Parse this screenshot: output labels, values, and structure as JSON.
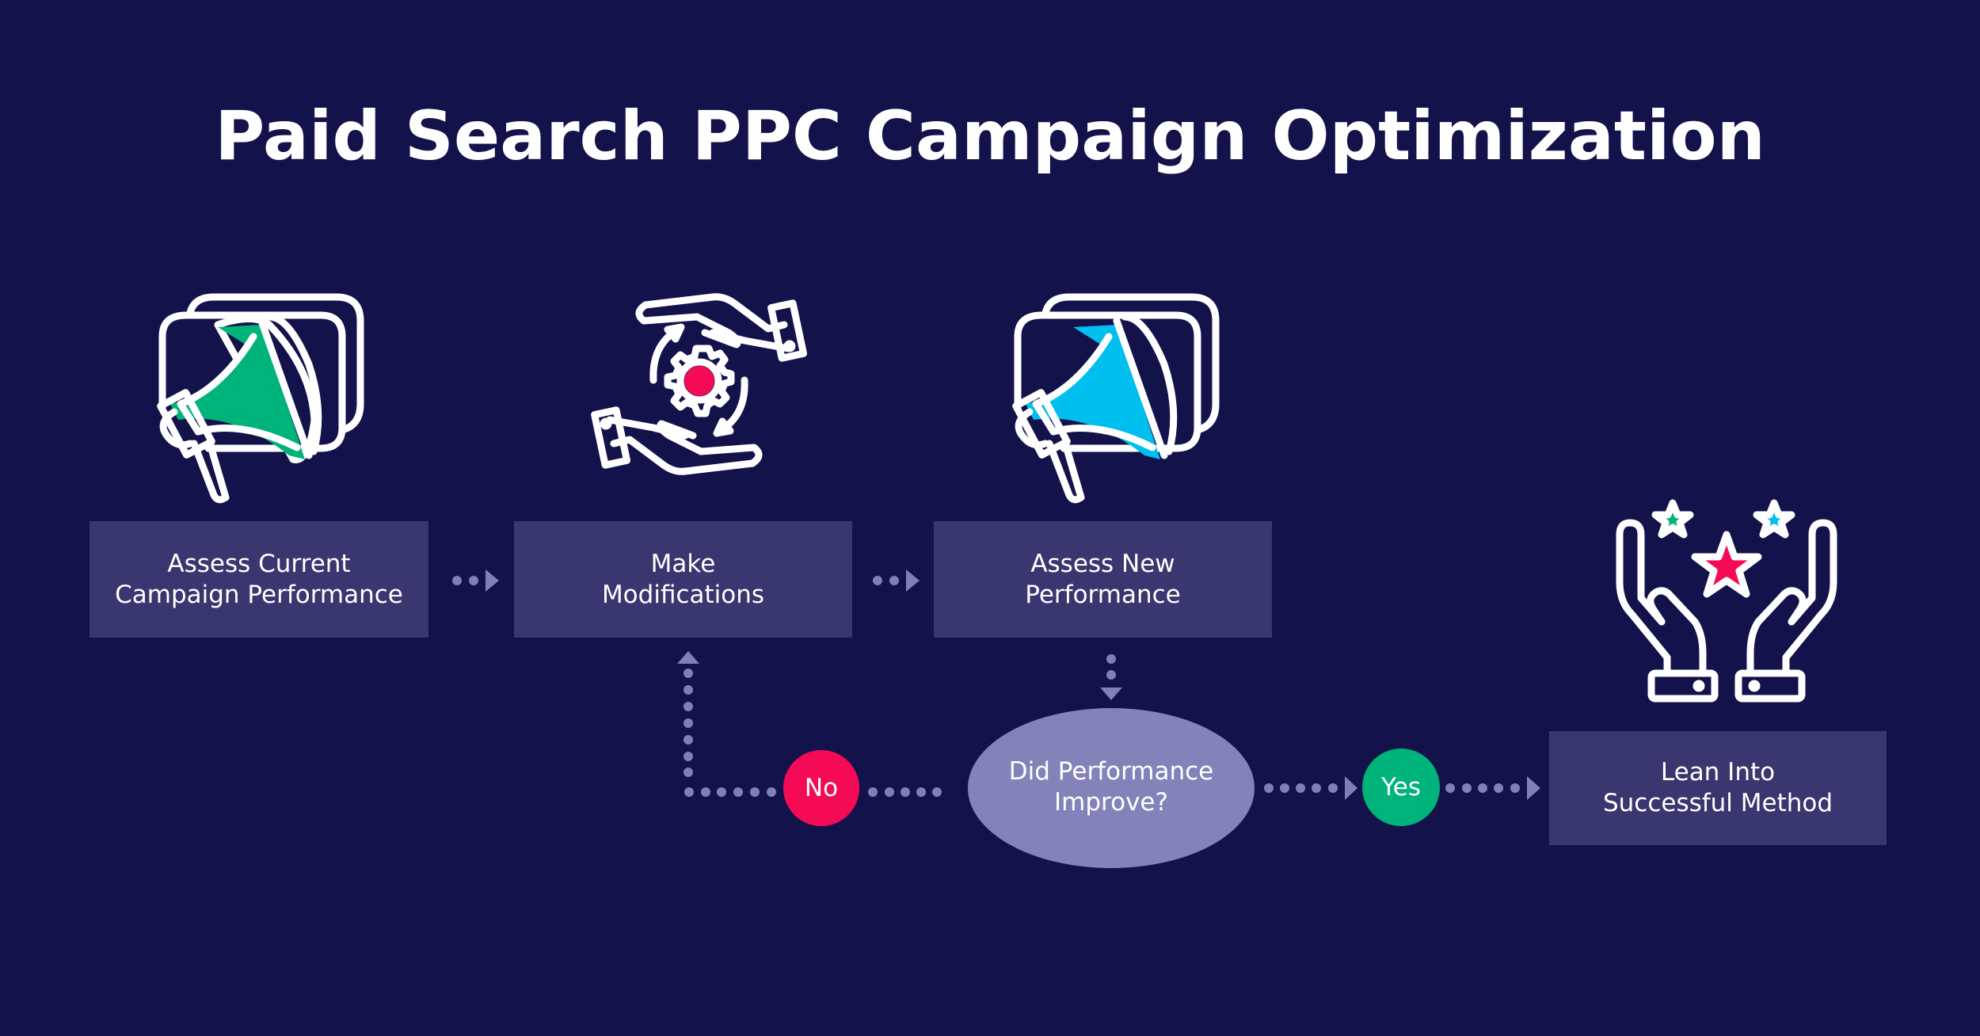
{
  "title": "Paid Search PPC Campaign Optimization",
  "colors": {
    "background": "#13124A",
    "box": "#393670",
    "connector": "#8080B8",
    "decision": "#8383BA",
    "no": "#F50A55",
    "yes": "#00B37A",
    "accent_green": "#00B37A",
    "accent_cyan": "#00BFEF",
    "accent_pink": "#F50A55"
  },
  "steps": [
    {
      "id": "assess-current",
      "label": "Assess Current\nCampaign Performance",
      "icon": "megaphone-screen-icon",
      "icon_accent": "green"
    },
    {
      "id": "make-modifications",
      "label": "Make\nModifications",
      "icon": "hands-gear-cycle-icon",
      "icon_accent": "pink"
    },
    {
      "id": "assess-new",
      "label": "Assess New\nPerformance",
      "icon": "megaphone-screen-icon",
      "icon_accent": "cyan"
    },
    {
      "id": "lean-into",
      "label": "Lean Into\nSuccessful Method",
      "icon": "hands-stars-icon",
      "icon_accent": "pink-green-cyan"
    }
  ],
  "decision": {
    "label": "Did Performance\nImprove?",
    "no_label": "No",
    "yes_label": "Yes"
  },
  "flow": [
    {
      "from": "assess-current",
      "to": "make-modifications"
    },
    {
      "from": "make-modifications",
      "to": "assess-new"
    },
    {
      "from": "assess-new",
      "to": "decision"
    },
    {
      "from": "decision",
      "to": "no",
      "then": "make-modifications"
    },
    {
      "from": "decision",
      "to": "yes",
      "then": "lean-into"
    }
  ]
}
